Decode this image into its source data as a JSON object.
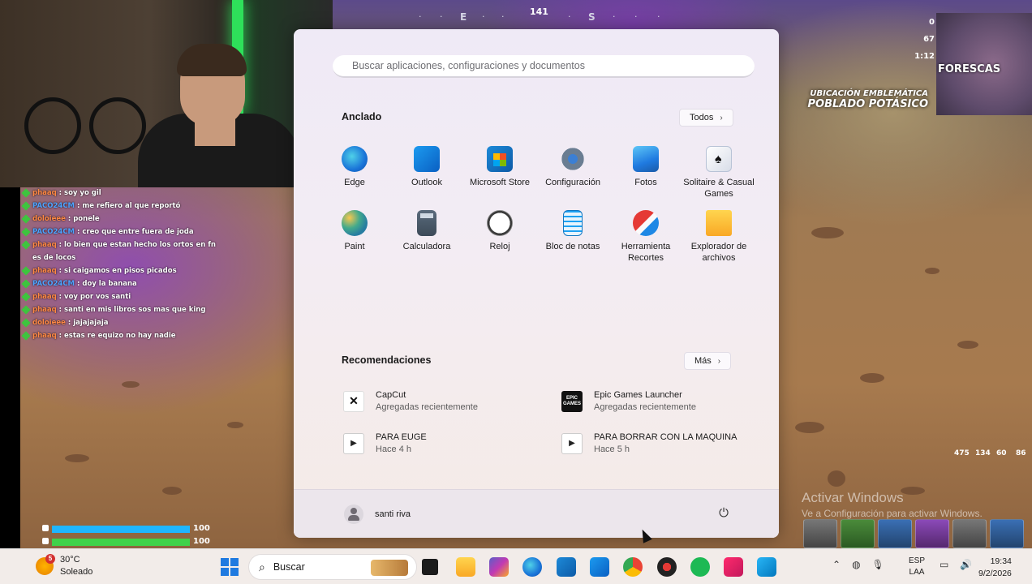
{
  "hud": {
    "compass": [
      "E",
      "S"
    ],
    "heading": "141",
    "stats": [
      "0",
      "67",
      "1:12"
    ],
    "location_label": "UBICACIÓN EMBLEMÁTICA",
    "location_name": "POBLADO POTÁSICO",
    "minimap_label": "FORESCAS",
    "health": {
      "shield": "100",
      "health": "100",
      "shield_color": "#1fb6ff",
      "health_color": "#3fd24a"
    },
    "ammo": [
      "475",
      "134",
      "60",
      "86"
    ],
    "activate_title": "Activar Windows",
    "activate_sub": "Ve a Configuración para activar Windows."
  },
  "chat": [
    {
      "user": "phaaq",
      "text": "soy yo gil",
      "color": "orange"
    },
    {
      "user": "PACO24CM",
      "text": "me refiero al que reportó",
      "color": "blue"
    },
    {
      "user": "doloieee",
      "text": "ponele",
      "color": "orange"
    },
    {
      "user": "PACO24CM",
      "text": "creo que entre fuera de joda",
      "color": "blue"
    },
    {
      "user": "phaaq",
      "text": "lo bien que estan hecho los ortos en fn es de locos",
      "color": "orange"
    },
    {
      "user": "phaaq",
      "text": "si caigamos en pisos picados",
      "color": "orange"
    },
    {
      "user": "PACO24CM",
      "text": "doy la banana",
      "color": "blue"
    },
    {
      "user": "phaaq",
      "text": "voy por vos santi",
      "color": "orange"
    },
    {
      "user": "phaaq",
      "text": "santi en mis libros sos mas que king",
      "color": "orange"
    },
    {
      "user": "doloieee",
      "text": "jajajajaja",
      "color": "orange"
    },
    {
      "user": "phaaq",
      "text": "estas re equizo no hay nadie",
      "color": "orange"
    }
  ],
  "start_menu": {
    "search_placeholder": "Buscar aplicaciones, configuraciones y documentos",
    "pinned_title": "Anclado",
    "all_button": "Todos",
    "pinned": [
      {
        "label": "Edge",
        "icon": "edge-icon"
      },
      {
        "label": "Outlook",
        "icon": "outlook-icon"
      },
      {
        "label": "Microsoft Store",
        "icon": "store-icon"
      },
      {
        "label": "Configuración",
        "icon": "settings-icon"
      },
      {
        "label": "Fotos",
        "icon": "photos-icon"
      },
      {
        "label": "Solitaire & Casual Games",
        "icon": "solitaire-icon"
      },
      {
        "label": "Paint",
        "icon": "paint-icon"
      },
      {
        "label": "Calculadora",
        "icon": "calculator-icon"
      },
      {
        "label": "Reloj",
        "icon": "clock-icon"
      },
      {
        "label": "Bloc de notas",
        "icon": "notepad-icon"
      },
      {
        "label": "Herramienta Recortes",
        "icon": "snipping-icon"
      },
      {
        "label": "Explorador de archivos",
        "icon": "folder-icon"
      }
    ],
    "recommended_title": "Recomendaciones",
    "more_button": "Más",
    "recommended": [
      {
        "title": "CapCut",
        "sub": "Agregadas recientemente",
        "icon": "capcut-icon"
      },
      {
        "title": "Epic Games Launcher",
        "sub": "Agregadas recientemente",
        "icon": "epic-icon"
      },
      {
        "title": "PARA EUGE",
        "sub": "Hace 4 h",
        "icon": "video-file-icon"
      },
      {
        "title": "PARA BORRAR CON LA MAQUINA",
        "sub": "Hace 5 h",
        "icon": "video-file-icon"
      }
    ],
    "user_name": "santi riva"
  },
  "taskbar": {
    "temperature": "30°C",
    "condition": "Soleado",
    "weather_badge": "5",
    "search_label": "Buscar",
    "language_1": "ESP",
    "language_2": "LAA",
    "time": "19:34",
    "date": "9/2/2026"
  }
}
